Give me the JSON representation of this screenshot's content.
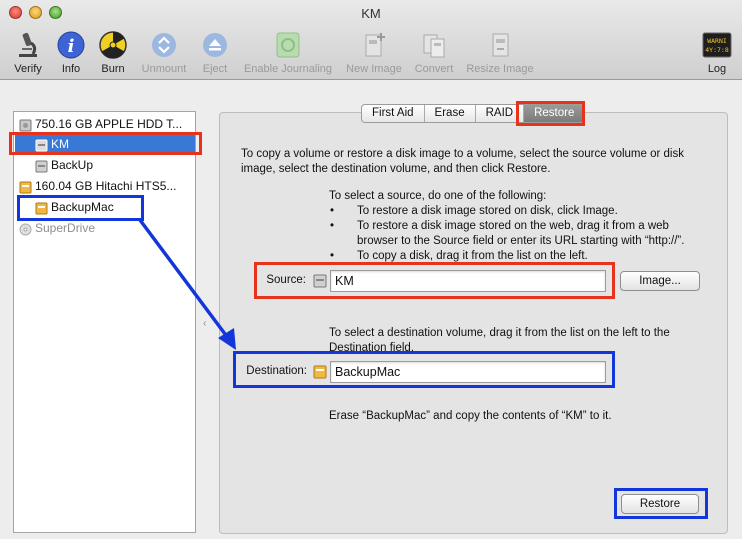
{
  "window": {
    "title": "KM"
  },
  "toolbar": {
    "items": [
      {
        "label": "Verify",
        "icon": "microscope-icon",
        "enabled": true
      },
      {
        "label": "Info",
        "icon": "info-icon",
        "enabled": true
      },
      {
        "label": "Burn",
        "icon": "burn-icon",
        "enabled": true
      },
      {
        "label": "Unmount",
        "icon": "unmount-icon",
        "enabled": false
      },
      {
        "label": "Eject",
        "icon": "eject-icon",
        "enabled": false
      },
      {
        "label": "Enable Journaling",
        "icon": "journaling-icon",
        "enabled": false
      },
      {
        "label": "New Image",
        "icon": "new-image-icon",
        "enabled": false
      },
      {
        "label": "Convert",
        "icon": "convert-icon",
        "enabled": false
      },
      {
        "label": "Resize Image",
        "icon": "resize-image-icon",
        "enabled": false
      }
    ],
    "log": {
      "label": "Log",
      "icon_text_1": "WARNI",
      "icon_text_2": "4Y:7:8"
    }
  },
  "sidebar": {
    "items": [
      {
        "label": "750.16 GB APPLE HDD T...",
        "kind": "disk"
      },
      {
        "label": "KM",
        "kind": "volume",
        "selected": true
      },
      {
        "label": "BackUp",
        "kind": "volume"
      },
      {
        "label": "160.04 GB Hitachi HTS5...",
        "kind": "external-disk"
      },
      {
        "label": "BackupMac",
        "kind": "external-volume"
      },
      {
        "label": "SuperDrive",
        "kind": "optical-drive",
        "disabled": true
      }
    ]
  },
  "tabs": [
    "First Aid",
    "Erase",
    "RAID",
    "Restore"
  ],
  "active_tab": "Restore",
  "restore": {
    "intro": "To copy a volume or restore a disk image to a volume, select the source volume or disk image, select the destination volume, and then click Restore.",
    "source_help_title": "To select a source, do one of the following:",
    "source_help_bullets": [
      "To restore a disk image stored on disk, click Image.",
      "To restore a disk image stored on the web, drag it from a web browser to the Source field or enter its URL starting with “http://”.",
      "To copy a disk, drag it from the list on the left."
    ],
    "source_label": "Source:",
    "source_value": "KM",
    "image_button": "Image...",
    "destination_help": "To select a destination volume, drag it from the list on the left to the Destination field.",
    "destination_label": "Destination:",
    "destination_value": "BackupMac",
    "summary": "Erase “BackupMac” and copy the contents of “KM” to it.",
    "restore_button": "Restore"
  },
  "colors": {
    "annotation_red": "#e8331c",
    "annotation_blue": "#1236d9",
    "selection": "#3a78d6"
  }
}
